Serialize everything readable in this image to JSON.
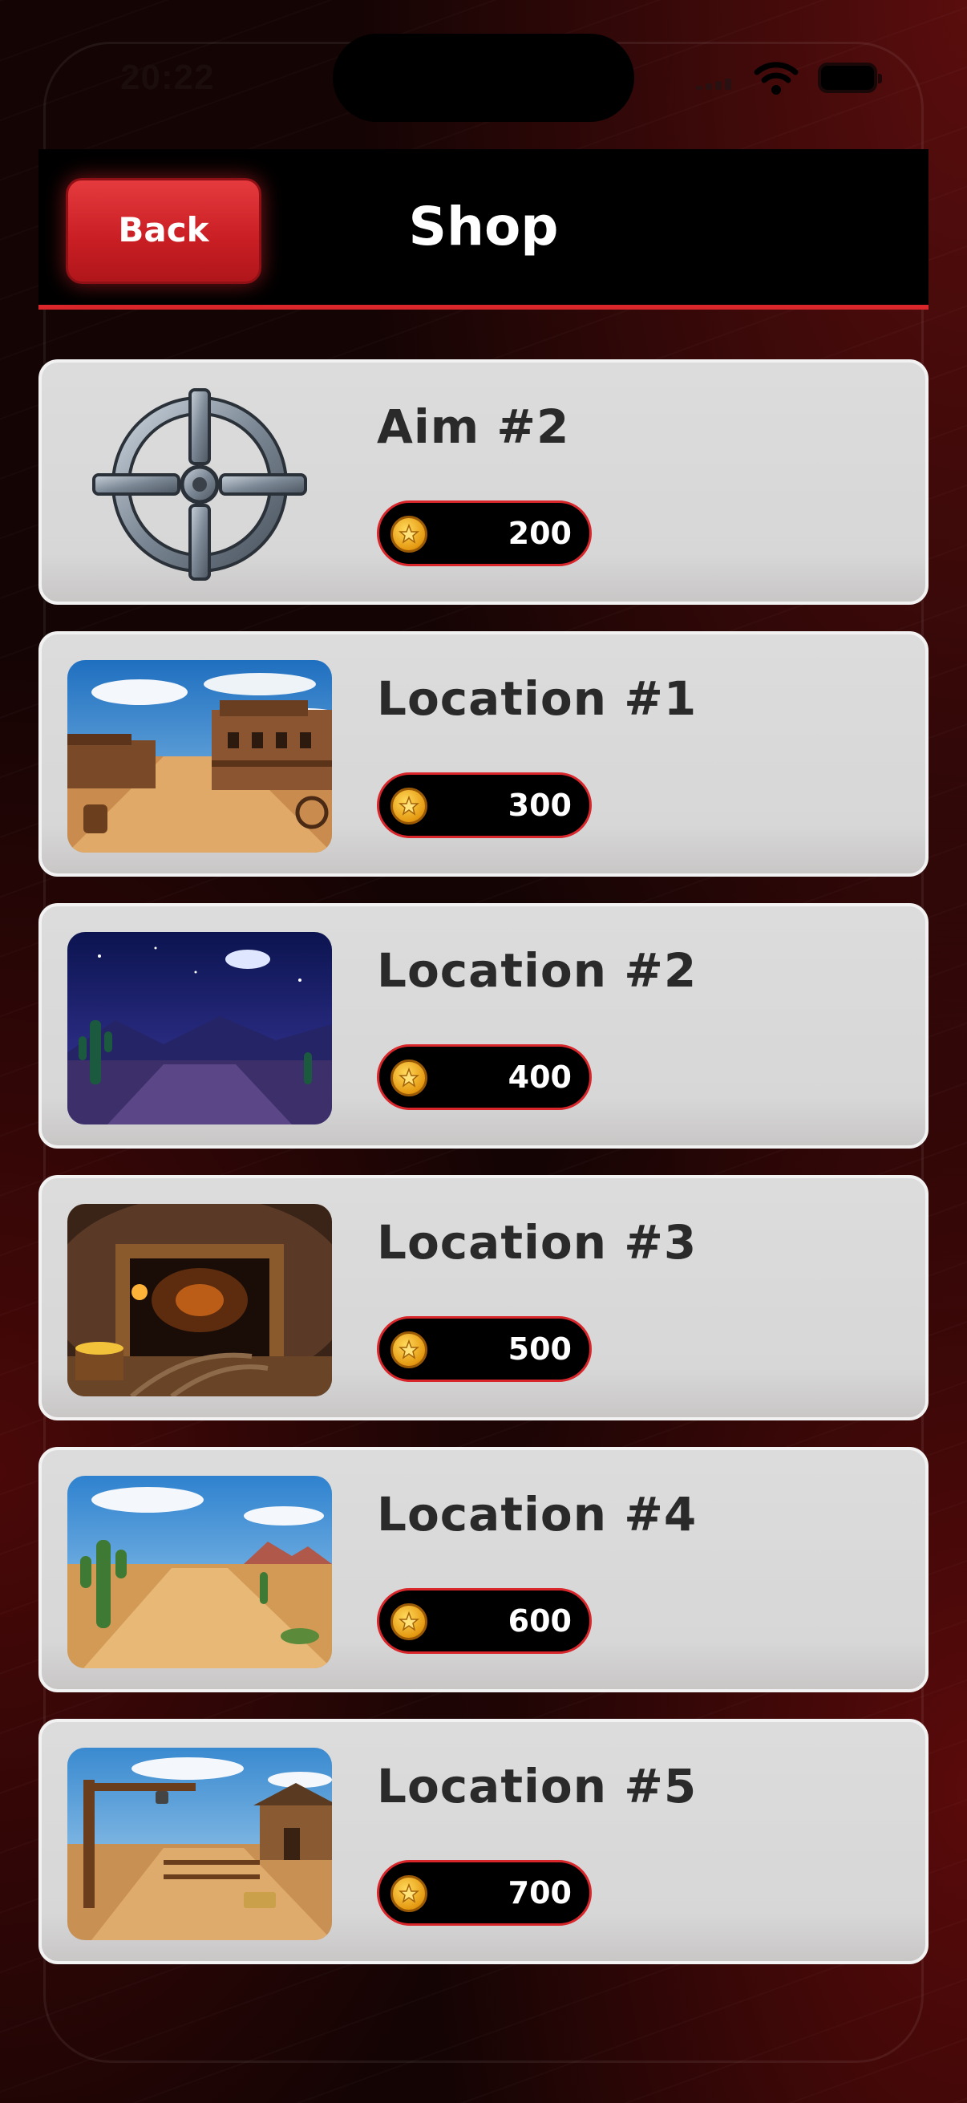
{
  "status_bar": {
    "time": "20:22"
  },
  "header": {
    "back_label": "Back",
    "title": "Shop"
  },
  "items": [
    {
      "name": "Aim #2",
      "price": "200",
      "image": "crosshair-icon"
    },
    {
      "name": "Location #1",
      "price": "300",
      "image": "western-town-image"
    },
    {
      "name": "Location #2",
      "price": "400",
      "image": "night-desert-image"
    },
    {
      "name": "Location #3",
      "price": "500",
      "image": "gold-mine-image"
    },
    {
      "name": "Location #4",
      "price": "600",
      "image": "desert-cactus-image"
    },
    {
      "name": "Location #5",
      "price": "700",
      "image": "ranch-image"
    }
  ],
  "colors": {
    "accent": "#d8262b",
    "card": "#d9d9d9",
    "coin": "#f0b52a"
  }
}
